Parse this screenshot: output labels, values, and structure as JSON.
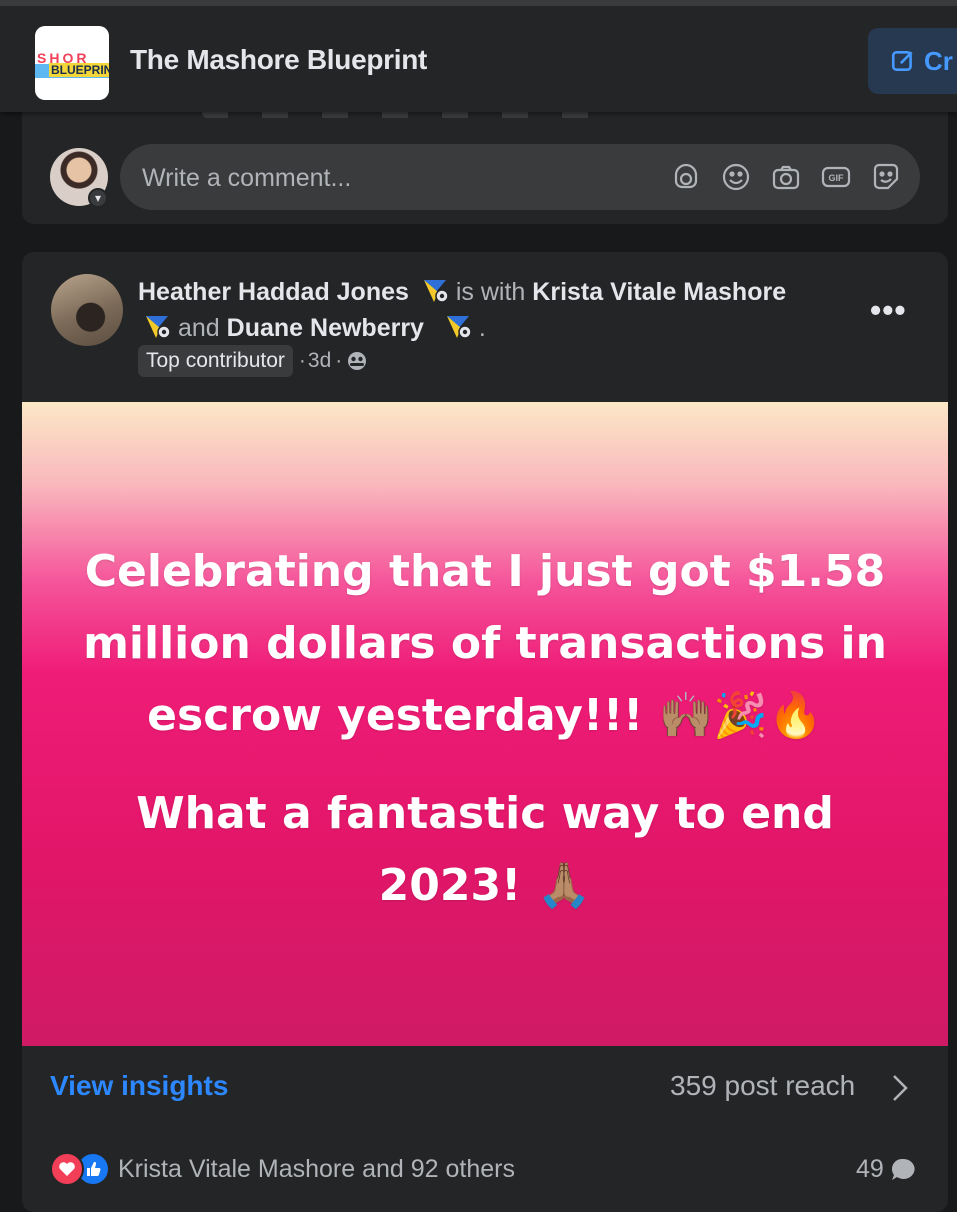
{
  "header": {
    "group_name": "The Mashore Blueprint",
    "logo_text_top": "SHOR",
    "logo_text_bottom": "BLUEPRIN",
    "create_label": "Cr",
    "create_icon": "edit-icon"
  },
  "comment_composer": {
    "placeholder": "Write a comment...",
    "icons": [
      "avatar-sticker-icon",
      "emoji-icon",
      "camera-icon",
      "gif-icon",
      "sticker-icon"
    ]
  },
  "post": {
    "author": "Heather Haddad Jones",
    "with_text": "is with",
    "tagged_1": "Krista Vitale Mashore",
    "and_text": "and",
    "tagged_2": "Duane Newberry",
    "end_punct": ".",
    "badge": "Top contributor",
    "time": "3d",
    "privacy_icon": "group-members-icon",
    "more_label": "•••",
    "hero_line_1": "Celebrating that I just got $1.58",
    "hero_line_2": "million dollars of transactions in",
    "hero_line_3": "escrow yesterday!!! 🙌🏽🎉🔥",
    "hero_line_4": "What a fantastic way to end",
    "hero_line_5": "2023! 🙏🏽",
    "hero_gradient": [
      "#fbe8c6",
      "#ef1c77",
      "#cf1a66"
    ],
    "insights_label": "View insights",
    "reach_label": "359 post reach",
    "reactions_text": "Krista Vitale Mashore and 92 others",
    "comments_count": "49"
  },
  "colors": {
    "background": "#18191a",
    "card": "#242526",
    "link": "#2d88ff",
    "love": "#f33e58",
    "like": "#1877f2"
  }
}
